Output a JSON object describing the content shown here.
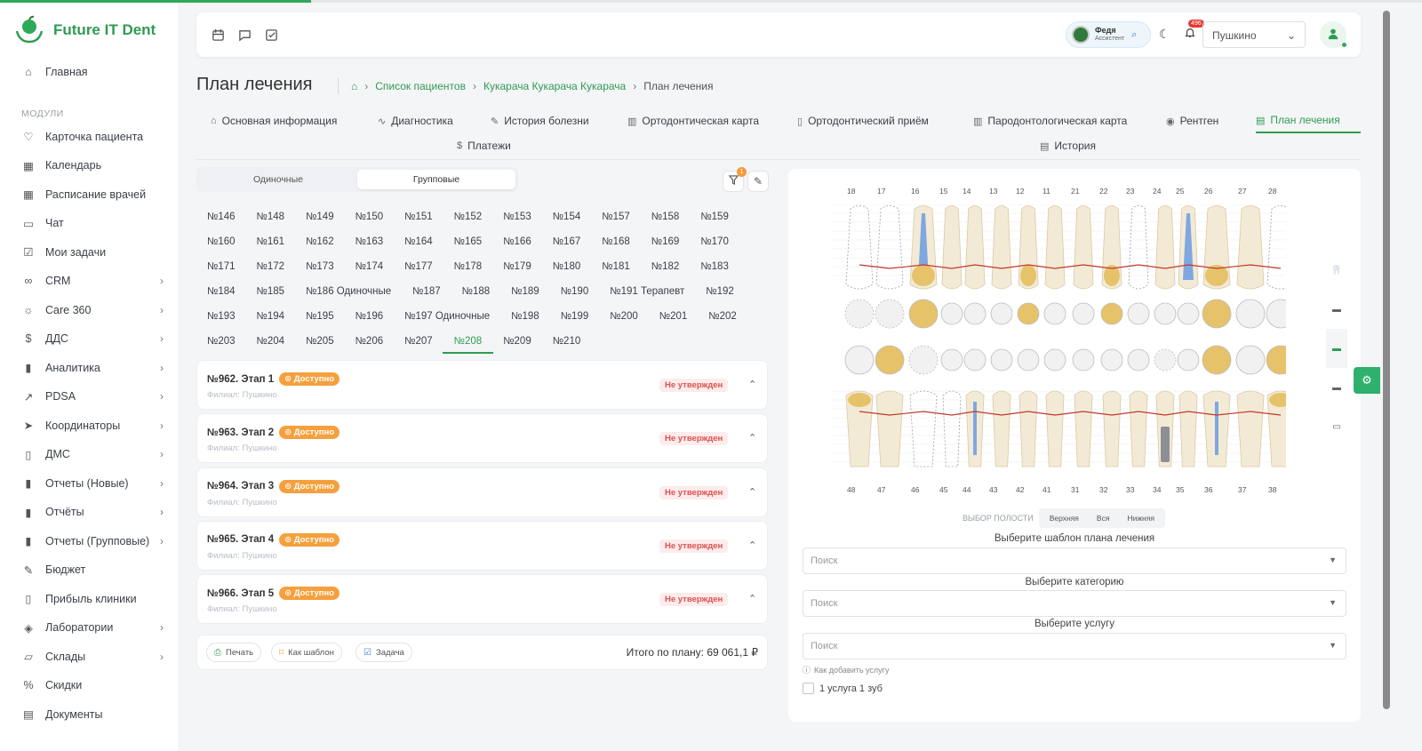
{
  "brand": {
    "name": "Future IT Dent",
    "accent": "#2f9b52"
  },
  "sidebar": {
    "home": "Главная",
    "section": "МОДУЛИ",
    "items": [
      {
        "label": "Карточка пациента",
        "icon": "heart-icon",
        "chev": false
      },
      {
        "label": "Календарь",
        "icon": "calendar-icon",
        "chev": false
      },
      {
        "label": "Расписание врачей",
        "icon": "calendar-icon",
        "chev": false
      },
      {
        "label": "Чат",
        "icon": "chat-icon",
        "chev": false
      },
      {
        "label": "Мои задачи",
        "icon": "checkbox-icon",
        "chev": false
      },
      {
        "label": "CRM",
        "icon": "crm-icon",
        "chev": true
      },
      {
        "label": "Care 360",
        "icon": "sun-icon",
        "chev": true
      },
      {
        "label": "ДДС",
        "icon": "dollar-icon",
        "chev": true
      },
      {
        "label": "Аналитика",
        "icon": "bar-chart-icon",
        "chev": true
      },
      {
        "label": "PDSA",
        "icon": "trend-icon",
        "chev": true
      },
      {
        "label": "Координаторы",
        "icon": "send-icon",
        "chev": true
      },
      {
        "label": "ДМС",
        "icon": "clipboard-icon",
        "chev": true
      },
      {
        "label": "Отчеты (Новые)",
        "icon": "bar-chart-icon",
        "chev": true
      },
      {
        "label": "Отчёты",
        "icon": "bar-chart-icon",
        "chev": true
      },
      {
        "label": "Отчеты (Групповые)",
        "icon": "bar-chart-icon",
        "chev": true
      },
      {
        "label": "Бюджет",
        "icon": "pen-icon",
        "chev": false
      },
      {
        "label": "Прибыль клиники",
        "icon": "clipboard-icon",
        "chev": false
      },
      {
        "label": "Лаборатории",
        "icon": "layers-icon",
        "chev": true
      },
      {
        "label": "Склады",
        "icon": "folder-icon",
        "chev": true
      },
      {
        "label": "Скидки",
        "icon": "percent-icon",
        "chev": false
      },
      {
        "label": "Документы",
        "icon": "document-icon",
        "chev": false
      }
    ]
  },
  "header": {
    "user_name": "Федя",
    "user_role": "Ассистент",
    "notifications": "496",
    "branch": "Пушкино"
  },
  "page": {
    "title": "План лечения",
    "breadcrumb": [
      "Список пациентов",
      "Кукарача Кукарача Кукарача",
      "План лечения"
    ]
  },
  "tabs": [
    {
      "label": "Основная информация",
      "icon": "⌂"
    },
    {
      "label": "Диагностика",
      "icon": "∿"
    },
    {
      "label": "История болезни",
      "icon": "✎"
    },
    {
      "label": "Ортодонтическая карта",
      "icon": "▥"
    },
    {
      "label": "Ортодонтический приём",
      "icon": "▯"
    },
    {
      "label": "Пародонтологическая карта",
      "icon": "▥"
    },
    {
      "label": "Рентген",
      "icon": "◉"
    },
    {
      "label": "План лечения",
      "icon": "▤"
    },
    {
      "label": "Платежи",
      "icon": "$"
    },
    {
      "label": "История",
      "icon": "▤"
    }
  ],
  "segment": {
    "single": "Одиночные",
    "group": "Групповые"
  },
  "filter_badge": "1",
  "plans": [
    [
      "№146",
      "№148",
      "№149",
      "№150",
      "№151",
      "№152",
      "№153",
      "№154",
      "№157",
      "№158",
      "№159"
    ],
    [
      "№160",
      "№161",
      "№162",
      "№163",
      "№164",
      "№165",
      "№166",
      "№167",
      "№168",
      "№169",
      "№170"
    ],
    [
      "№171",
      "№172",
      "№173",
      "№174",
      "№177",
      "№178",
      "№179",
      "№180",
      "№181",
      "№182",
      "№183"
    ],
    [
      "№184",
      "№185",
      "№186 Одиночные",
      "№187",
      "№188",
      "№189",
      "№190",
      "№191 Терапевт",
      "№192"
    ],
    [
      "№193",
      "№194",
      "№195",
      "№196",
      "№197 Одиночные",
      "№198",
      "№199",
      "№200",
      "№201",
      "№202"
    ],
    [
      "№203",
      "№204",
      "№205",
      "№206",
      "№207",
      "№208",
      "№209",
      "№210"
    ]
  ],
  "active_plan": "№208",
  "stages": [
    {
      "title": "№962. Этап 1",
      "status": "Доступно",
      "branch": "Филиал: Пушкино",
      "approval": "Не утвержден"
    },
    {
      "title": "№963. Этап 2",
      "status": "Доступно",
      "branch": "Филиал: Пушкино",
      "approval": "Не утвержден"
    },
    {
      "title": "№964. Этап 3",
      "status": "Доступно",
      "branch": "Филиал: Пушкино",
      "approval": "Не утвержден"
    },
    {
      "title": "№965. Этап 4",
      "status": "Доступно",
      "branch": "Филиал: Пушкино",
      "approval": "Не утвержден"
    },
    {
      "title": "№966. Этап 5",
      "status": "Доступно",
      "branch": "Филиал: Пушкино",
      "approval": "Не утвержден"
    }
  ],
  "footer": {
    "print": "Печать",
    "template": "Как шаблон",
    "task": "Задача",
    "total": "Итого по плану: 69 061,1 ₽"
  },
  "teeth": {
    "upper": [
      "18",
      "17",
      "16",
      "15",
      "14",
      "13",
      "12",
      "11",
      "21",
      "22",
      "23",
      "24",
      "25",
      "26",
      "27",
      "28"
    ],
    "lower": [
      "48",
      "47",
      "46",
      "45",
      "44",
      "43",
      "42",
      "41",
      "31",
      "32",
      "33",
      "34",
      "35",
      "36",
      "37",
      "38"
    ]
  },
  "jaw": {
    "label": "ВЫБОР ПОЛОСТИ",
    "options": [
      "Верхняя",
      "Вся",
      "Нижняя"
    ]
  },
  "form": {
    "template_label": "Выберите шаблон плана лечения",
    "category_label": "Выберите категорию",
    "service_label": "Выберите услугу",
    "placeholder": "Поиск",
    "howto": "Как добавить услугу",
    "one_per_tooth": "1 услуга 1 зуб"
  }
}
